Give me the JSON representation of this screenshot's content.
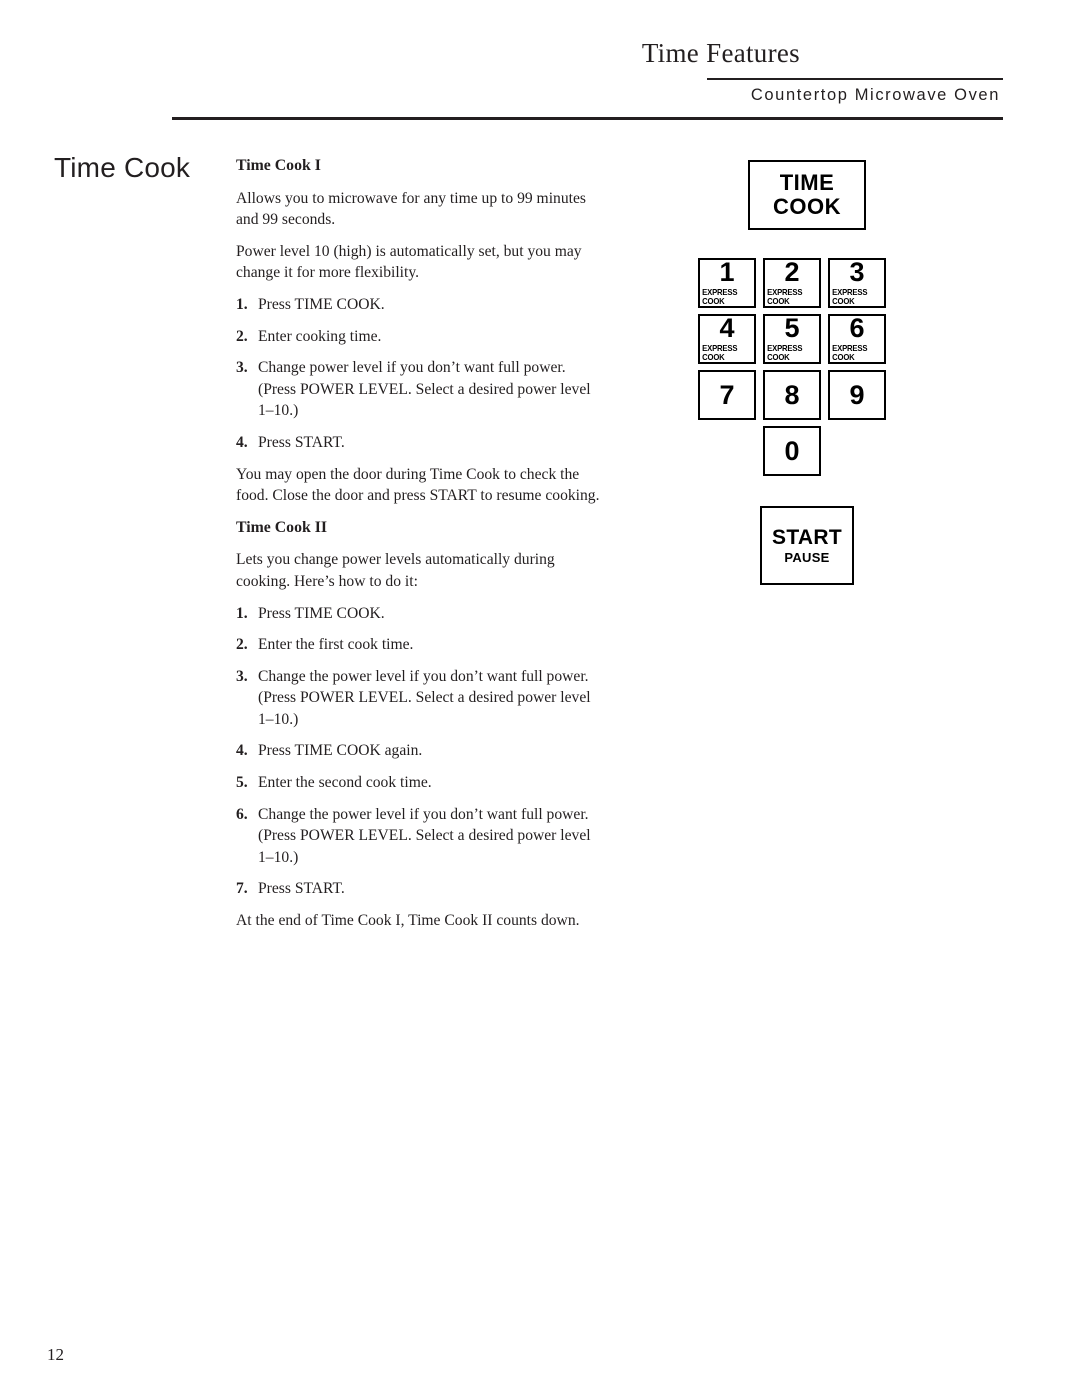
{
  "header": {
    "title": "Time Features",
    "subtitle": "Countertop Microwave Oven"
  },
  "side_heading": "Time Cook",
  "content": {
    "section1_heading": "Time Cook I",
    "section1_para1": "Allows you to microwave for any time up to 99 minutes and 99 seconds.",
    "section1_para2": "Power level 10 (high) is automatically set, but you may change it for more flexibility.",
    "section1_steps": [
      {
        "num": "1.",
        "text": "Press TIME COOK."
      },
      {
        "num": "2.",
        "text": "Enter cooking time."
      },
      {
        "num": "3.",
        "text": "Change power level if you don’t want full power. (Press POWER LEVEL. Select a desired power level 1–10.)"
      },
      {
        "num": "4.",
        "text": "Press START."
      }
    ],
    "section1_para3": "You may open the door during Time Cook to check the food. Close the door and press START to resume cooking.",
    "section2_heading": "Time Cook II",
    "section2_para1": "Lets you change power levels automatically during cooking. Here’s how to do it:",
    "section2_steps": [
      {
        "num": "1.",
        "text": "Press TIME COOK."
      },
      {
        "num": "2.",
        "text": "Enter the first cook time."
      },
      {
        "num": "3.",
        "text": "Change the power level if you don’t want full power. (Press POWER LEVEL. Select a desired power level 1–10.)"
      },
      {
        "num": "4.",
        "text": "Press TIME COOK again."
      },
      {
        "num": "5.",
        "text": "Enter the second cook time."
      },
      {
        "num": "6.",
        "text": "Change the power level if you don’t want full power. (Press POWER LEVEL. Select a desired power level 1–10.)"
      },
      {
        "num": "7.",
        "text": "Press START."
      }
    ],
    "section2_para2": "At the end of Time Cook I, Time Cook II counts down."
  },
  "keypad": {
    "time_cook_line1": "TIME",
    "time_cook_line2": "COOK",
    "express_label": "EXPRESS COOK",
    "keys": [
      {
        "digit": "1",
        "sub": "EXPRESS COOK"
      },
      {
        "digit": "2",
        "sub": "EXPRESS COOK"
      },
      {
        "digit": "3",
        "sub": "EXPRESS COOK"
      },
      {
        "digit": "4",
        "sub": "EXPRESS COOK"
      },
      {
        "digit": "5",
        "sub": "EXPRESS COOK"
      },
      {
        "digit": "6",
        "sub": "EXPRESS COOK"
      },
      {
        "digit": "7",
        "sub": ""
      },
      {
        "digit": "8",
        "sub": ""
      },
      {
        "digit": "9",
        "sub": ""
      },
      {
        "digit": "0",
        "sub": ""
      }
    ],
    "start_line1": "START",
    "start_line2": "PAUSE"
  },
  "page_number": "12",
  "colors": {
    "ink": "#231f20",
    "rule": "#231f20",
    "key_border": "#000000",
    "page_background": "#ffffff"
  }
}
